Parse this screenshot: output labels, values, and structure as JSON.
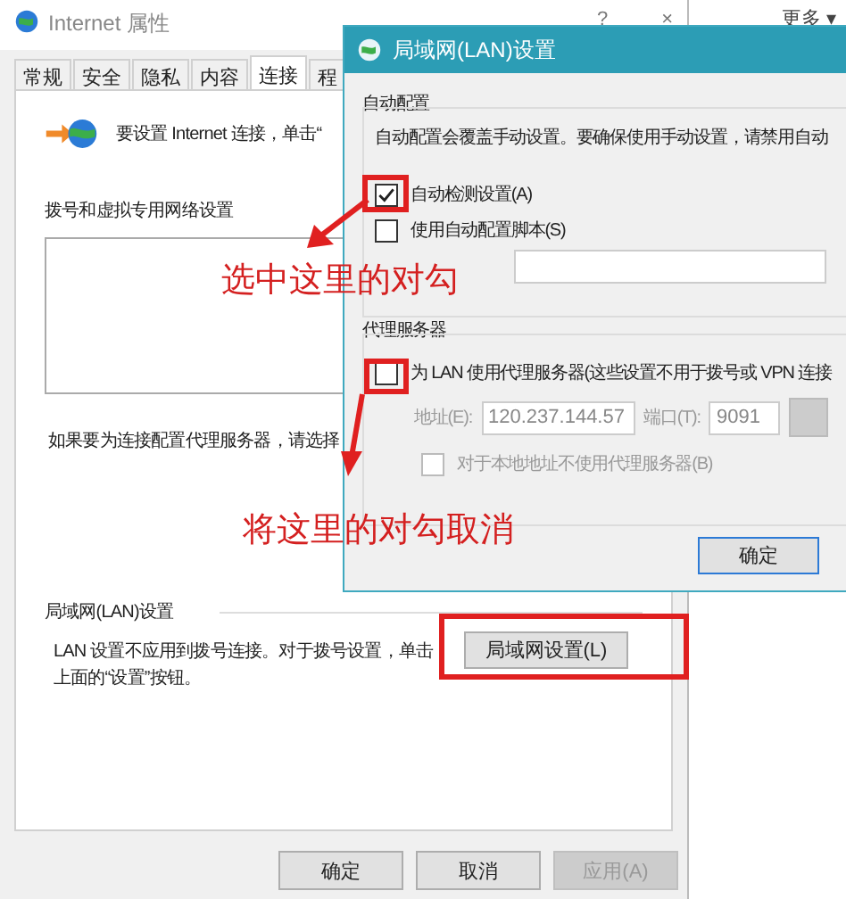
{
  "window": {
    "title": "Internet 属性",
    "title_buttons": [
      "?",
      "×"
    ]
  },
  "background_window": {
    "menu": "更多 ▾"
  },
  "tabs": [
    {
      "label": "常规",
      "selected": false
    },
    {
      "label": "安全",
      "selected": false
    },
    {
      "label": "隐私",
      "selected": false
    },
    {
      "label": "内容",
      "selected": false
    },
    {
      "label": "连接",
      "selected": true
    },
    {
      "label": "程",
      "selected": false
    }
  ],
  "connections": {
    "intro_text": "要设置 Internet 连接，单击“",
    "dialup_heading": "拨号和虚拟专用网络设置",
    "proxy_hint": "如果要为连接配置代理服务器，请选择",
    "lan_heading": "局域网(LAN)设置",
    "lan_text": "LAN 设置不应用到拨号连接。对于拨号设置，单击上面的“设置”按钮。",
    "lan_button": "局域网设置(L)"
  },
  "buttons": [
    {
      "label": "确定",
      "disabled": false
    },
    {
      "label": "取消",
      "disabled": false
    },
    {
      "label": "应用(A)",
      "disabled": true
    }
  ],
  "lan_dialog": {
    "title": "局域网(LAN)设置",
    "auto_config": {
      "heading": "自动配置",
      "text": "自动配置会覆盖手动设置。要确保使用手动设置，请禁用自动",
      "options": [
        {
          "label": "自动检测设置(A)",
          "checked": true
        },
        {
          "label": "使用自动配置脚本(S)",
          "checked": false
        }
      ]
    },
    "proxy": {
      "heading": "代理服务器",
      "use_proxy": {
        "label": "为 LAN 使用代理服务器(这些设置不用于拨号或 VPN 连接",
        "checked": false
      },
      "address_label": "地址(E):",
      "address": "120.237.144.57",
      "port_label": "端口(T):",
      "port": "9091",
      "bypass": {
        "label": "对于本地地址不使用代理服务器(B)",
        "checked": false
      }
    },
    "ok_button": "确定"
  },
  "annotations": [
    {
      "text": "选中这里的对勾"
    },
    {
      "text": "将这里的对勾取消"
    }
  ]
}
